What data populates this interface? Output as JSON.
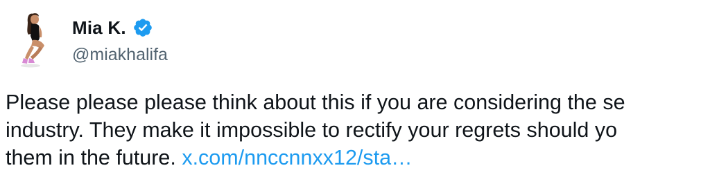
{
  "author": {
    "display_name": "Mia K.",
    "handle": "@miakhalifa",
    "verified_icon": "verified-badge-icon"
  },
  "tweet": {
    "line1": "Please please please think about this if you are considering the se",
    "line2": "industry. They make it impossible to rectify your regrets should yo",
    "line3_text": "them in the future. ",
    "link_text": "x.com/nnccnnxx12/sta…"
  },
  "colors": {
    "text": "#0f1419",
    "secondary_text": "#536471",
    "link": "#1d9bf0",
    "verified": "#1d9bf0"
  }
}
